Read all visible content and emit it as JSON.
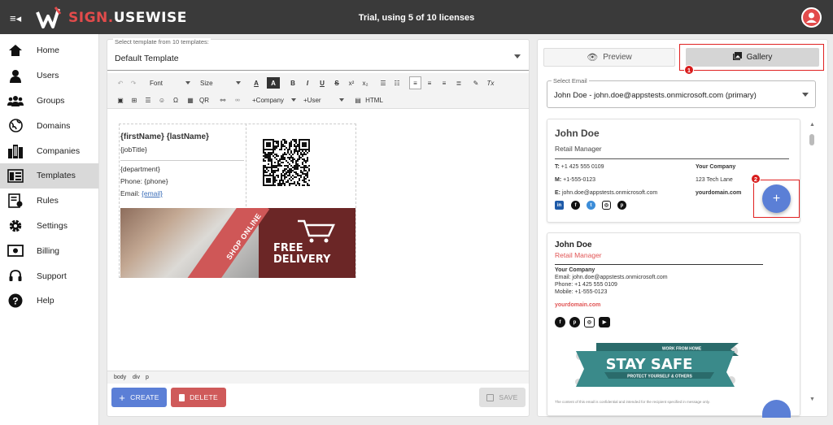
{
  "app": {
    "brand_sign": "SIGN.",
    "brand_usewise": "USEWISE",
    "trial_text": "Trial, using 5 of 10 licenses"
  },
  "sidebar": {
    "items": [
      {
        "label": "Home",
        "icon": "home-icon"
      },
      {
        "label": "Users",
        "icon": "user-icon"
      },
      {
        "label": "Groups",
        "icon": "groups-icon"
      },
      {
        "label": "Domains",
        "icon": "globe-icon"
      },
      {
        "label": "Companies",
        "icon": "building-icon"
      },
      {
        "label": "Templates",
        "icon": "template-icon",
        "active": true
      },
      {
        "label": "Rules",
        "icon": "rules-icon"
      },
      {
        "label": "Settings",
        "icon": "gear-icon"
      },
      {
        "label": "Billing",
        "icon": "billing-icon"
      },
      {
        "label": "Support",
        "icon": "headset-icon"
      },
      {
        "label": "Help",
        "icon": "help-icon"
      }
    ]
  },
  "editor": {
    "select_label": "Select template from 10 templates:",
    "selected_template": "Default Template",
    "toolbar": {
      "font": "Font",
      "size": "Size",
      "company": "+Company",
      "user": "+User",
      "qr": "QR",
      "html": "HTML"
    },
    "signature": {
      "name": "{firstName} {lastName}",
      "job": "{jobTitle}",
      "department": "{department}",
      "phone": "Phone: {phone}",
      "email_label": "Email:",
      "email_value": "{email}",
      "banner_shop": "SHOP ONLINE",
      "banner_free": "FREE",
      "banner_delivery": "DELIVERY"
    },
    "status_path": [
      "body",
      "div",
      "p"
    ],
    "create_label": "CREATE",
    "delete_label": "DELETE",
    "save_label": "SAVE"
  },
  "right": {
    "tab_preview": "Preview",
    "tab_gallery": "Gallery",
    "email_label": "Select Email",
    "email_value": "John Doe - john.doe@appstests.onmicrosoft.com (primary)",
    "card1": {
      "name": "John Doe",
      "title": "Retail Manager",
      "t": "T:",
      "t_val": "+1 425 555 0109",
      "m": "M:",
      "m_val": "+1-555-0123",
      "e": "E:",
      "e_val": "john.doe@appstests.onmicrosoft.com",
      "company": "Your Company",
      "address": "123 Tech Lane",
      "domain": "yourdomain.com"
    },
    "card2": {
      "name": "John Doe",
      "title": "Retail Manager",
      "company": "Your Company",
      "email": "Email: john.doe@appstests.onmicrosoft.com",
      "phone": "Phone: +1 425 555 0109",
      "mobile": "Mobile: +1-555-0123",
      "domain": "yourdomain.com",
      "banner_top": "WORK FROM HOME",
      "banner_main": "STAY SAFE",
      "banner_sub": "PROTECT YOURSELF & OTHERS",
      "disclaimer": "The content of this email is confidential and intended for the recipient specified in message only."
    },
    "badge1": "1",
    "badge2": "2"
  },
  "colors": {
    "accent": "#5b7fd6",
    "danger": "#cf5a5a",
    "highlight": "#e02020",
    "brand_red": "#e24b4b"
  }
}
